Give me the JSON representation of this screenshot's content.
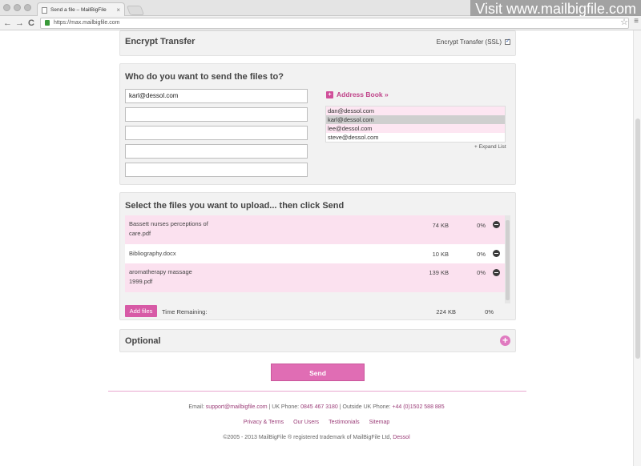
{
  "browser": {
    "tab_title": "Send a file – MailBigFile",
    "tab_close": "×",
    "url": "https://max.mailbigfile.com",
    "back": "←",
    "forward": "→",
    "reload": "C",
    "star": "☆",
    "menu": "≡"
  },
  "watermark": "Visit www.mailbigfile.com",
  "encrypt": {
    "title": "Encrypt Transfer",
    "option_label": "Encrypt Transfer (SSL)",
    "checked": true
  },
  "recipients": {
    "title": "Who do you want to send the files to?",
    "fields": [
      "karl@dessol.com",
      "",
      "",
      "",
      ""
    ],
    "address_book_label": "Address Book »",
    "address_book": [
      "dan@dessol.com",
      "karl@dessol.com",
      "lee@dessol.com",
      "steve@dessol.com"
    ],
    "expand_label": "+ Expand List"
  },
  "files": {
    "title": "Select the files you want to upload... then click Send",
    "rows": [
      {
        "name_line1": "Bassett nurses perceptions of",
        "name_line2": "care.pdf",
        "size": "74 KB",
        "progress": "0%"
      },
      {
        "name_line1": "Bibliography.docx",
        "name_line2": "",
        "size": "10 KB",
        "progress": "0%"
      },
      {
        "name_line1": "aromatherapy massage",
        "name_line2": "1999.pdf",
        "size": "139 KB",
        "progress": "0%"
      }
    ],
    "add_label": "Add files",
    "time_label": "Time Remaining:",
    "total_size": "224 KB",
    "total_progress": "0%"
  },
  "optional": {
    "title": "Optional",
    "expand_symbol": "+"
  },
  "send_label": "Send",
  "footer": {
    "email_prefix": "Email:",
    "email": "support@mailbigfile.com",
    "uk_phone_label": "| UK Phone:",
    "uk_phone": "0845 467 3180",
    "outside_label": "| Outside UK Phone:",
    "outside_phone": "+44 (0)1502 588 885",
    "links": [
      "Privacy & Terms",
      "Our Users",
      "Testimonials",
      "Sitemap"
    ],
    "copyright": "©2005 - 2013 MailBigFile ® registered trademark of MailBigFile Ltd,",
    "company": "Dessol"
  },
  "colors": {
    "accent": "#d75aa6",
    "row_pink": "#fbe1ef"
  }
}
